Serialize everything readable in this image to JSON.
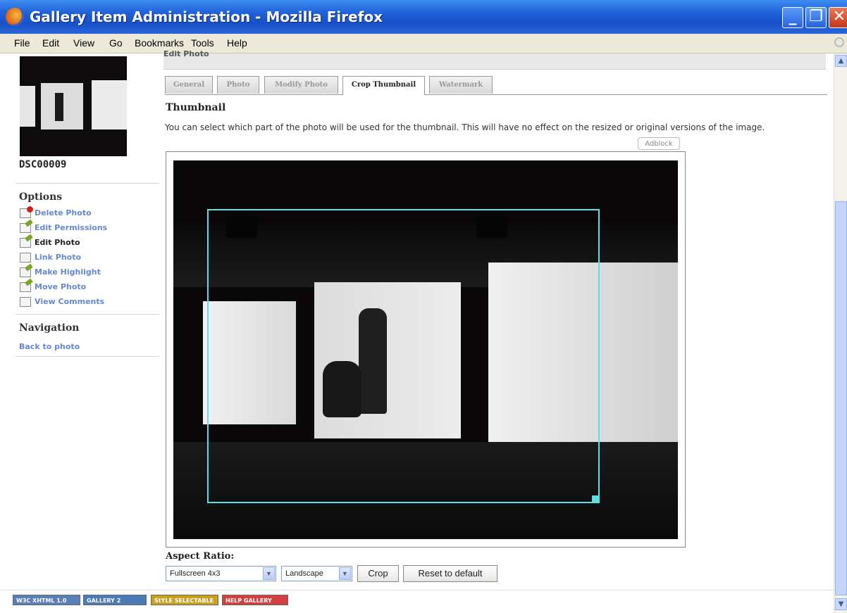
{
  "window": {
    "title": "Gallery Item Administration - Mozilla Firefox",
    "min_label": "_",
    "max_label": "❐",
    "close_label": "✕"
  },
  "menu": [
    "File",
    "Edit",
    "View",
    "Go",
    "Bookmarks",
    "Tools",
    "Help"
  ],
  "sidebar": {
    "item_title": "DSC00009",
    "options_heading": "Options",
    "options": [
      {
        "label": "Delete Photo",
        "icon": "delete-icon"
      },
      {
        "label": "Edit Permissions",
        "icon": "edit-permissions-icon"
      },
      {
        "label": "Edit Photo",
        "icon": "edit-photo-icon",
        "current": true
      },
      {
        "label": "Link Photo",
        "icon": "link-icon"
      },
      {
        "label": "Make Highlight",
        "icon": "highlight-icon"
      },
      {
        "label": "Move Photo",
        "icon": "move-icon"
      },
      {
        "label": "View Comments",
        "icon": "comments-icon"
      }
    ],
    "navigation_heading": "Navigation",
    "back_link": "Back to photo"
  },
  "main": {
    "section_heading": "Edit Photo",
    "tabs": [
      {
        "label": "General",
        "active": false
      },
      {
        "label": "Photo",
        "active": false
      },
      {
        "label": "Modify Photo",
        "active": false
      },
      {
        "label": "Crop Thumbnail",
        "active": true
      },
      {
        "label": "Watermark",
        "active": false
      }
    ],
    "thumbnail_heading": "Thumbnail",
    "thumbnail_description": "You can select which part of the photo will be used for the thumbnail. This will have no effect on the resized or original versions of the image.",
    "adblock_tab": "Adblock",
    "aspect_ratio_label": "Aspect Ratio:",
    "aspect_ratio_value": "Fullscreen 4x3",
    "orientation_value": "Landscape",
    "crop_button": "Crop",
    "reset_button": "Reset to default"
  },
  "footer_badges": [
    {
      "label": "W3C XHTML 1.0",
      "color": "#5a7fb8"
    },
    {
      "label": "GALLERY 2",
      "color": "#4a7ab8"
    },
    {
      "label": "StYLE SELECTABLE",
      "color": "#c8a020"
    },
    {
      "label": "HELP GALLERY",
      "color": "#d24040"
    }
  ],
  "colors": {
    "crop_rectangle": "#5fe0e0",
    "link": "#6688cc",
    "titlebar": "#1e5fd8"
  }
}
